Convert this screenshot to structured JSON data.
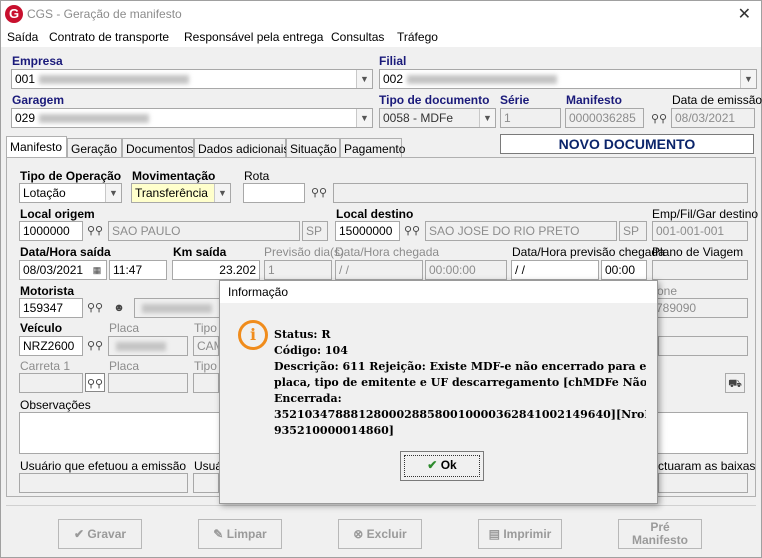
{
  "window": {
    "logo": "G",
    "title": "CGS - Geração de manifesto",
    "close_glyph": "✕"
  },
  "menu": [
    "Saída",
    "Contrato de transporte",
    "Responsável pela entrega",
    "Consultas",
    "Tráfego"
  ],
  "header": {
    "empresa_label": "Empresa",
    "empresa_value": "001",
    "filial_label": "Filial",
    "filial_value": "002",
    "garagem_label": "Garagem",
    "garagem_value": "029",
    "tipo_doc_label": "Tipo de documento",
    "tipo_doc_value": "0058 - MDFe",
    "serie_label": "Série",
    "serie_value": "1",
    "manifesto_label": "Manifesto",
    "manifesto_value": "0000036285",
    "data_emissao_label": "Data de emissão",
    "data_emissao_value": "08/03/2021"
  },
  "tabs": [
    "Manifesto",
    "Geração",
    "Documentos",
    "Dados adicionais",
    "Situação",
    "Pagamento"
  ],
  "status_banner": "NOVO DOCUMENTO",
  "form": {
    "tipo_operacao_label": "Tipo de Operação",
    "tipo_operacao_value": "Lotação",
    "movimentacao_label": "Movimentação",
    "movimentacao_value": "Transferência",
    "rota_label": "Rota",
    "rota_value": "",
    "local_origem_label": "Local origem",
    "local_origem_code": "1000000",
    "local_origem_city": "SAO PAULO",
    "local_origem_uf": "SP",
    "local_destino_label": "Local destino",
    "local_destino_code": "15000000",
    "local_destino_city": "SAO JOSE DO RIO PRETO",
    "local_destino_uf": "SP",
    "emp_fil_gar_label": "Emp/Fil/Gar destino",
    "emp_fil_gar_value": "001-001-001",
    "data_saida_label": "Data/Hora saída",
    "data_saida_value": "08/03/2021",
    "hora_saida_value": "11:47",
    "km_saida_label": "Km saída",
    "km_saida_value": "23.202",
    "previsao_label": "Previsão dia(s)",
    "previsao_value": "1",
    "data_chegada_label": "Data/Hora chegada",
    "data_chegada_value": " / /",
    "hora_chegada_value": "00:00:00",
    "previsao_chegada_label": "Data/Hora previsão chegada",
    "previsao_chegada_date": " / /",
    "previsao_chegada_time": "00:00",
    "plano_viagem_label": "Plano de Viagem",
    "motorista_label": "Motorista",
    "motorista_value": "159347",
    "telefone_label": "one",
    "telefone_value": "789090",
    "veiculo_label": "Veículo",
    "veiculo_value": "NRZ2600",
    "placa_label": "Placa",
    "tipo_label": "Tipo",
    "tipo_value": "CAM",
    "carreta_label": "Carreta 1",
    "placa2_label": "Placa",
    "tipo2_label": "Tipo",
    "observacoes_label": "Observações",
    "usuario_emissao_label": "Usuário que efetuou a emissão",
    "usuario2_label": "Usuá",
    "baixas_label": "ctuaram as baixas"
  },
  "buttons": {
    "gravar": "Gravar",
    "limpar": "Limpar",
    "excluir": "Excluir",
    "imprimir": "Imprimir",
    "pre_manifesto": "Pré\nManifesto"
  },
  "dialog": {
    "title": "Informação",
    "icon": "i",
    "message": "Status: R\nCódigo: 104\nDescrição: 611 Rejeição: Existe MDF-e não encerrado para esta\nplaca, tipo de emitente e UF descarregamento [chMDFe Não\nEncerrada:\n35210347888128000288580010000362841002149640][NroProtoc\n935210000014860]",
    "ok_label": "Ok",
    "ok_check": "✔"
  }
}
